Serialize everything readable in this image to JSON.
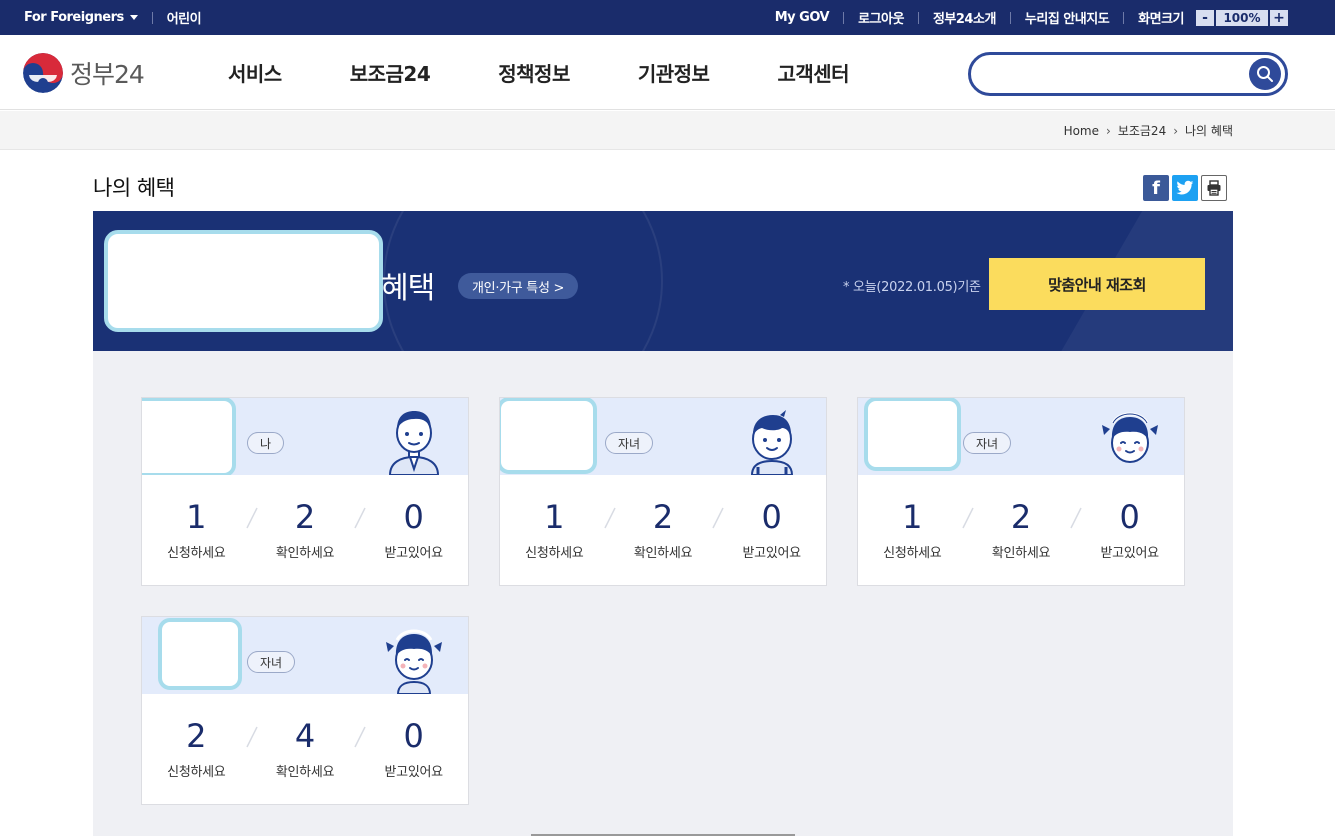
{
  "topbar": {
    "for_foreigners": "For Foreigners",
    "kids": "어린이",
    "my_gov": "My GOV",
    "logout": "로그아웃",
    "about": "정부24소개",
    "sitemap": "누리집 안내지도",
    "screen_size": "화면크기",
    "zoom_minus": "-",
    "zoom_value": "100%",
    "zoom_plus": "+"
  },
  "header": {
    "logo_text": "정부24",
    "menu": [
      "서비스",
      "보조금24",
      "정책정보",
      "기관정보",
      "고객센터"
    ],
    "search_placeholder": ""
  },
  "breadcrumb": {
    "home": "Home",
    "level1": "보조금24",
    "level2": "나의 혜택"
  },
  "page": {
    "title": "나의 혜택",
    "share_facebook": "f"
  },
  "banner": {
    "suffix": "혜택",
    "pill": "개인·가구 특성 >",
    "today": "* 오늘(2022.01.05)기준",
    "button": "맞춤안내 재조회"
  },
  "stat_labels": [
    "신청하세요",
    "확인하세요",
    "받고있어요"
  ],
  "cards": [
    {
      "role": "나",
      "avatar": "adult-male-avatar",
      "values": [
        "1",
        "2",
        "0"
      ]
    },
    {
      "role": "자녀",
      "avatar": "boy-avatar",
      "values": [
        "1",
        "2",
        "0"
      ]
    },
    {
      "role": "자녀",
      "avatar": "girl-avatar",
      "values": [
        "1",
        "2",
        "0"
      ]
    },
    {
      "role": "자녀",
      "avatar": "girl-avatar",
      "values": [
        "2",
        "4",
        "0"
      ]
    }
  ],
  "colors": {
    "navy": "#1a2c6b",
    "banner": "#1a3175",
    "yellow_button": "#fbdc5d",
    "card_head": "#e3ebfb",
    "redacted_border": "#a7dcec"
  }
}
